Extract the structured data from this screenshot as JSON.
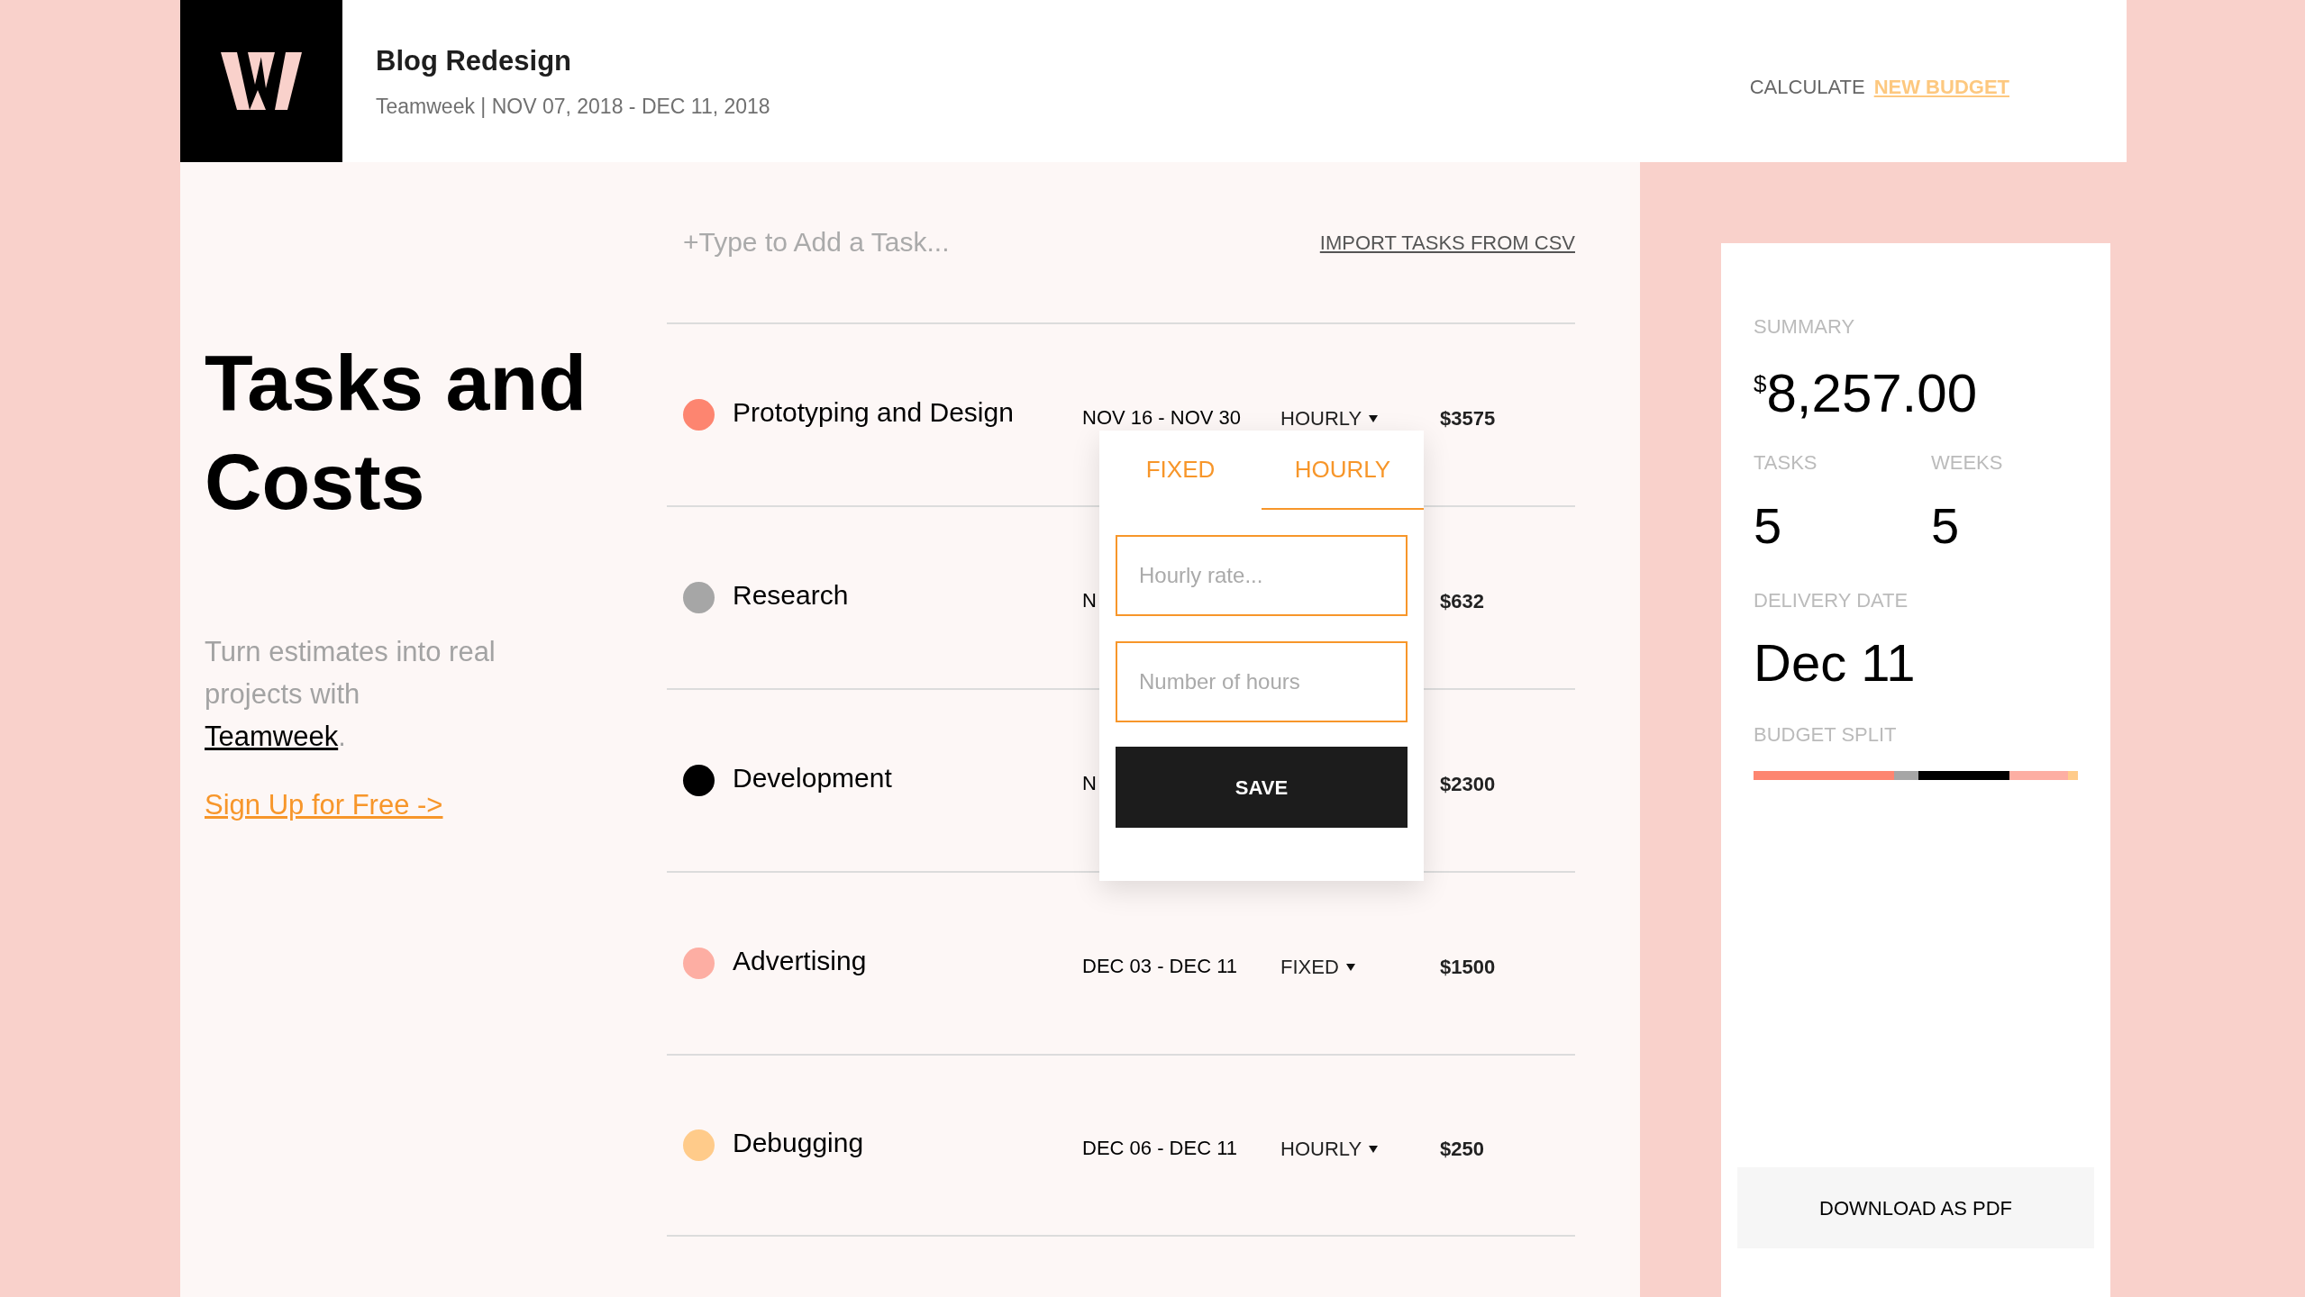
{
  "header": {
    "title": "Blog Redesign",
    "subtitle": "Teamweek | NOV 07, 2018 - DEC 11, 2018",
    "calculate_label": "CALCULATE",
    "calculate_link": "NEW BUDGET"
  },
  "intro": {
    "heading": "Tasks and Costs",
    "text_before": "Turn estimates into real projects with",
    "link": "Teamweek",
    "text_after": ".",
    "signup": "Sign Up for Free ->"
  },
  "task_input": {
    "placeholder": "+Type to Add a Task..."
  },
  "import_link": "IMPORT TASKS FROM CSV",
  "tasks": [
    {
      "name": "Prototyping and Design",
      "color": "#fd8570",
      "dates": "NOV 16 - NOV 30",
      "type": "HOURLY",
      "amount": "$3575"
    },
    {
      "name": "Research",
      "color": "#a6a6a6",
      "dates": "N",
      "amount": "$632"
    },
    {
      "name": "Development",
      "color": "#000000",
      "dates": "N",
      "amount": "$2300"
    },
    {
      "name": "Advertising",
      "color": "#fdaea3",
      "dates": "DEC 03 - DEC 11",
      "type": "FIXED",
      "amount": "$1500"
    },
    {
      "name": "Debugging",
      "color": "#ffcb8a",
      "dates": "DEC 06 - DEC 11",
      "type": "HOURLY",
      "amount": "$250"
    }
  ],
  "popup": {
    "tabs": [
      {
        "label": "FIXED",
        "selected": false
      },
      {
        "label": "HOURLY",
        "selected": true
      }
    ],
    "fields": [
      {
        "placeholder": "Hourly rate..."
      },
      {
        "placeholder": "Number of hours"
      }
    ],
    "button": "SAVE"
  },
  "summary": {
    "label": "SUMMARY",
    "currency": "$",
    "total": "8,257.00",
    "stats": [
      {
        "label": "TASKS",
        "value": "5"
      },
      {
        "label": "WEEKS",
        "value": "5"
      }
    ],
    "delivery_label": "DELIVERY DATE",
    "delivery_value": "Dec 11",
    "split_label": "BUDGET SPLIT",
    "download": "DOWNLOAD AS PDF"
  }
}
